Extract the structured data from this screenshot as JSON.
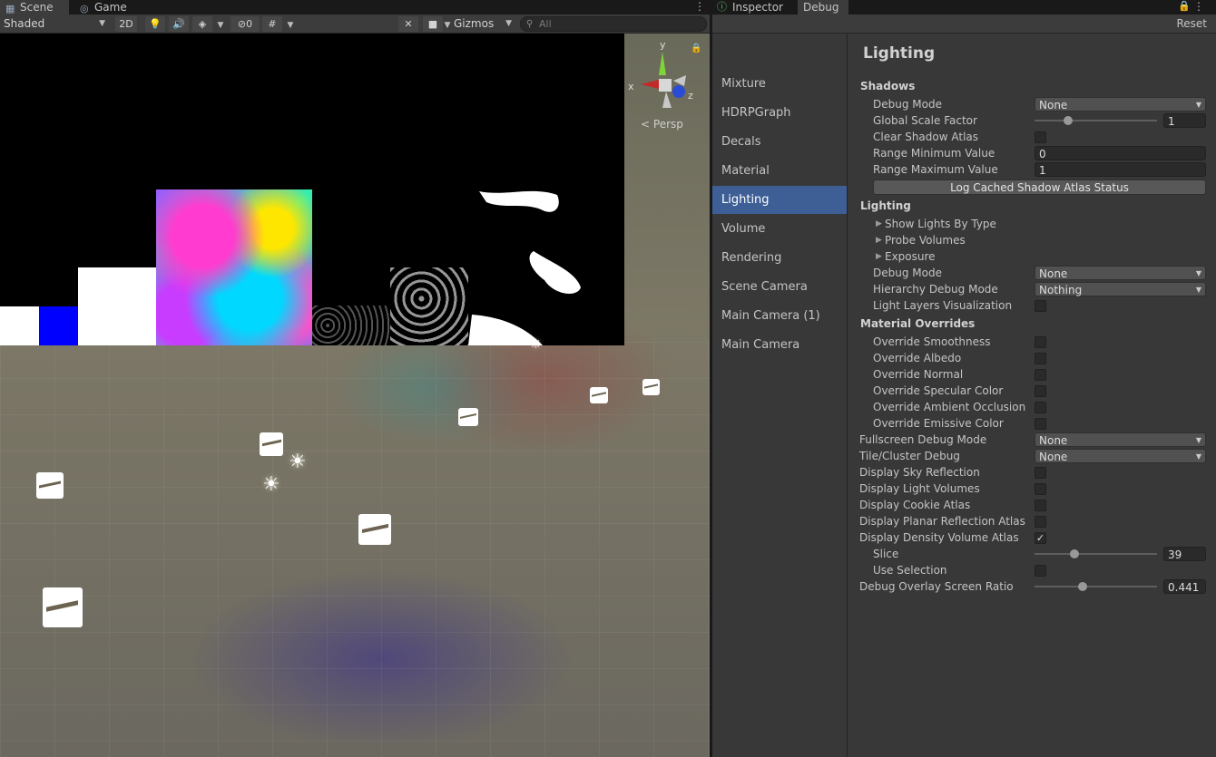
{
  "scene": {
    "tabs": {
      "scene": "Scene",
      "game": "Game"
    },
    "toolbar": {
      "shading_mode": "Shaded",
      "mode_2d": "2D",
      "hidden_count": "0",
      "gizmos": "Gizmos",
      "search_placeholder": "All"
    },
    "view": {
      "persp_label": "Persp",
      "axis_x": "x",
      "axis_y": "y",
      "axis_z": "z"
    }
  },
  "inspector": {
    "tabs": {
      "inspector": "Inspector",
      "debug": "Debug"
    },
    "reset_label": "Reset",
    "sidebar": [
      "Mixture",
      "HDRPGraph",
      "Decals",
      "Material",
      "Lighting",
      "Volume",
      "Rendering",
      "Scene Camera",
      "Main Camera (1)",
      "Main Camera"
    ],
    "selected_sidebar": "Lighting",
    "panel_title": "Lighting",
    "shadows": {
      "header": "Shadows",
      "debug_mode_label": "Debug Mode",
      "debug_mode_value": "None",
      "global_scale_label": "Global Scale Factor",
      "global_scale_value": "1",
      "clear_atlas_label": "Clear Shadow Atlas",
      "range_min_label": "Range Minimum Value",
      "range_min_value": "0",
      "range_max_label": "Range Maximum Value",
      "range_max_value": "1",
      "log_button": "Log Cached Shadow Atlas Status"
    },
    "lighting": {
      "header": "Lighting",
      "show_lights": "Show Lights By Type",
      "probe_volumes": "Probe Volumes",
      "exposure": "Exposure",
      "debug_mode_label": "Debug Mode",
      "debug_mode_value": "None",
      "hierarchy_label": "Hierarchy Debug Mode",
      "hierarchy_value": "Nothing",
      "light_layers_label": "Light Layers Visualization"
    },
    "material_overrides": {
      "header": "Material Overrides",
      "items": [
        "Override Smoothness",
        "Override Albedo",
        "Override Normal",
        "Override Specular Color",
        "Override Ambient Occlusion",
        "Override Emissive Color"
      ]
    },
    "fullscreen_label": "Fullscreen Debug Mode",
    "fullscreen_value": "None",
    "tile_label": "Tile/Cluster Debug",
    "tile_value": "None",
    "display_sky": "Display Sky Reflection",
    "display_light_volumes": "Display Light Volumes",
    "display_cookie": "Display Cookie Atlas",
    "display_planar": "Display Planar Reflection Atlas",
    "display_density": "Display Density Volume Atlas",
    "display_density_checked": true,
    "slice_label": "Slice",
    "slice_value": "39",
    "use_selection_label": "Use Selection",
    "overlay_ratio_label": "Debug Overlay Screen Ratio",
    "overlay_ratio_value": "0.441",
    "check_mark": "✓",
    "colors": {
      "selection": "#3e5f96",
      "panel_bg": "#383838"
    }
  }
}
